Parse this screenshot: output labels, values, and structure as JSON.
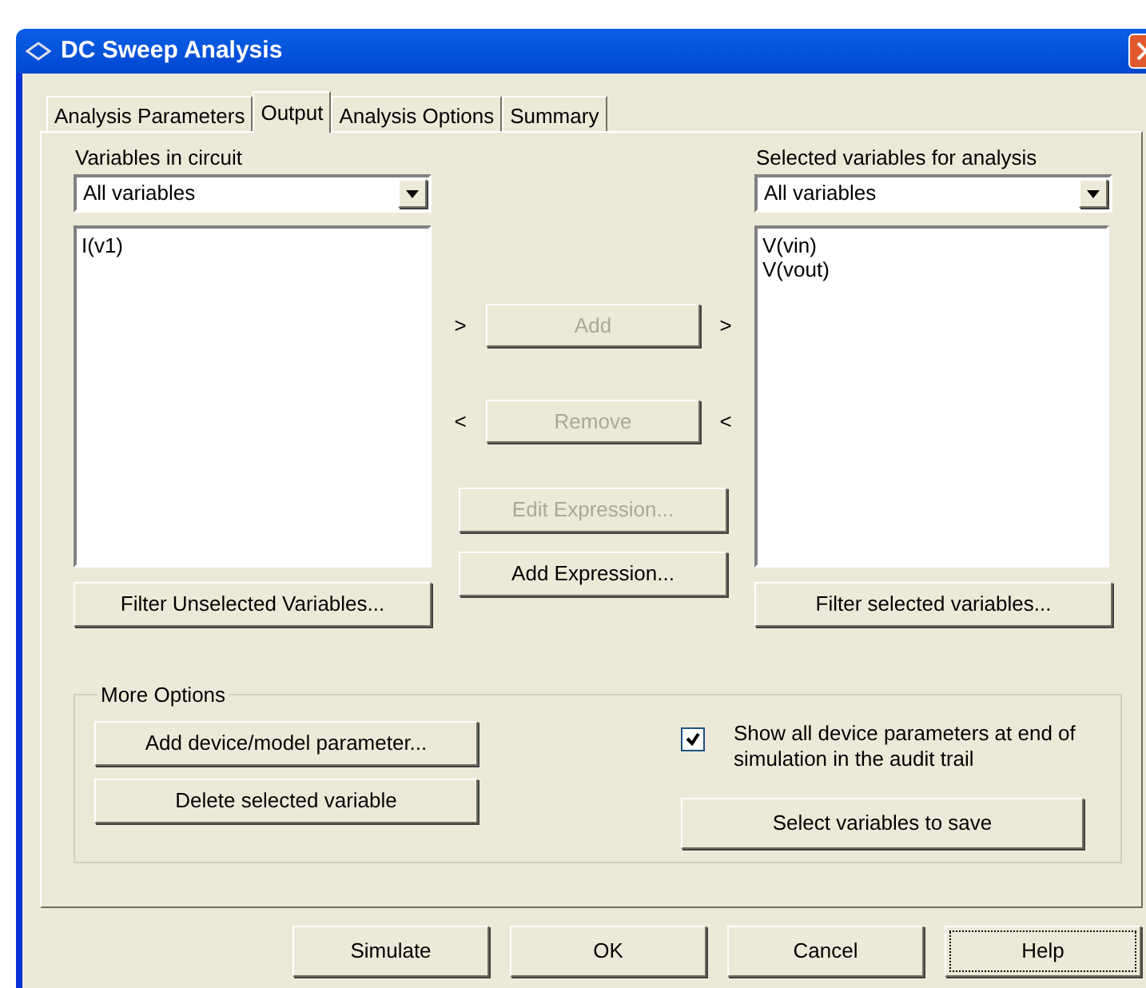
{
  "window": {
    "title": "DC Sweep Analysis"
  },
  "tabs": [
    {
      "label": "Analysis Parameters",
      "selected": false
    },
    {
      "label": "Output",
      "selected": true
    },
    {
      "label": "Analysis Options",
      "selected": false
    },
    {
      "label": "Summary",
      "selected": false
    }
  ],
  "left": {
    "label": "Variables in circuit",
    "dropdown": "All variables",
    "items": [
      "I(v1)"
    ],
    "button": "Filter Unselected Variables..."
  },
  "right": {
    "label": "Selected variables for analysis",
    "dropdown": "All variables",
    "items": [
      "V(vin)",
      "V(vout)"
    ],
    "button": "Filter selected variables..."
  },
  "middle": {
    "add": {
      "label": "Add",
      "disabled": true,
      "left_arrow": ">",
      "right_arrow": ">"
    },
    "remove": {
      "label": "Remove",
      "disabled": true,
      "left_arrow": "<",
      "right_arrow": "<"
    },
    "edit": {
      "label": "Edit Expression...",
      "disabled": true
    },
    "add_expression": {
      "label": "Add Expression...",
      "disabled": false
    }
  },
  "more_options": {
    "title": "More Options",
    "buttons": [
      "Add device/model parameter...",
      "Delete selected variable"
    ],
    "checkbox": {
      "label": "Show all device parameters at end of simulation in the audit trail",
      "checked": true
    },
    "save_button": "Select variables to save"
  },
  "buttons": [
    {
      "label": "Simulate",
      "focused": false
    },
    {
      "label": "OK",
      "focused": false
    },
    {
      "label": "Cancel",
      "focused": false
    },
    {
      "label": "Help",
      "focused": true
    }
  ]
}
